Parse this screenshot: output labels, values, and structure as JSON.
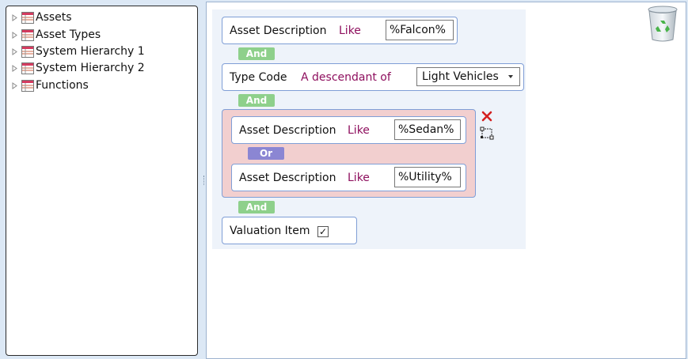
{
  "tree": {
    "items": [
      {
        "label": "Assets"
      },
      {
        "label": "Asset Types"
      },
      {
        "label": "System Hierarchy 1"
      },
      {
        "label": "System Hierarchy 2"
      },
      {
        "label": "Functions"
      }
    ]
  },
  "builder": {
    "conditions": [
      {
        "field": "Asset Description",
        "operator": "Like",
        "value": "%Falcon%"
      },
      {
        "field": "Type Code",
        "operator": "A descendant of",
        "value": "Light Vehicles"
      }
    ],
    "group": {
      "conditions": [
        {
          "field": "Asset Description",
          "operator": "Like",
          "value": "%Sedan%"
        },
        {
          "field": "Asset Description",
          "operator": "Like",
          "value": "%Utility%"
        }
      ],
      "joiner": "Or"
    },
    "joiner": "And",
    "last_condition": {
      "field": "Valuation Item",
      "checked": true,
      "check_mark": "✓"
    }
  },
  "icons": {
    "recycle_bin": "recycle-bin-icon",
    "delete": "delete-x-icon",
    "ungroup": "ungroup-icon",
    "table": "table-icon",
    "expand": "expand-arrow-icon"
  },
  "colors": {
    "operator": "#8e0f5e",
    "and_pill": "#8ed08b",
    "or_pill": "#8b86d3",
    "group_bg": "#f2cfcf",
    "border": "#7f9ed6"
  }
}
